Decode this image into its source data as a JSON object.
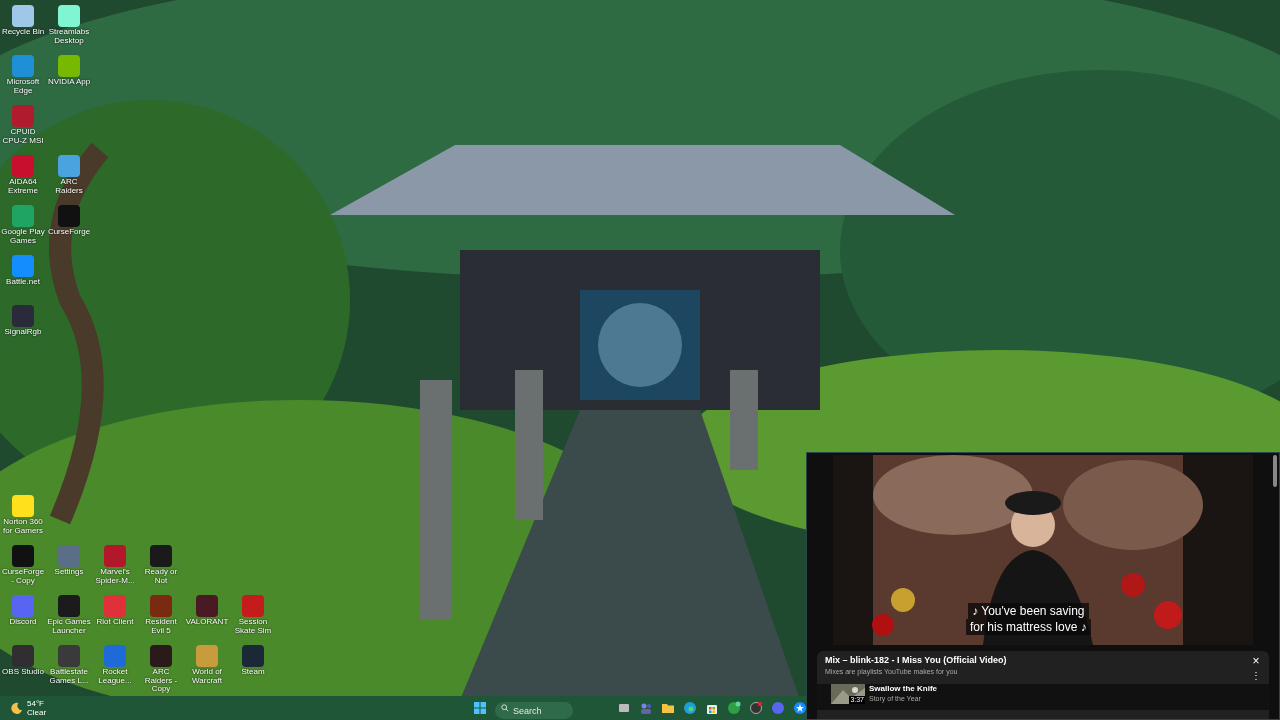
{
  "desktop": {
    "top_rows": [
      [
        {
          "label": "Recycle Bin",
          "color": "#9fc7e8"
        },
        {
          "label": "Streamlabs Desktop",
          "color": "#80f5d2"
        }
      ],
      [
        {
          "label": "Microsoft Edge",
          "color": "#1f8fd6"
        },
        {
          "label": "NVIDIA App",
          "color": "#76b900"
        }
      ],
      [
        {
          "label": "CPUID CPU-Z MSI",
          "color": "#b01c2e"
        }
      ],
      [
        {
          "label": "AIDA64 Extreme",
          "color": "#c8102e"
        },
        {
          "label": "ARC Raiders",
          "color": "#4aa3df"
        }
      ],
      [
        {
          "label": "Google Play Games",
          "color": "#1fa463"
        },
        {
          "label": "CurseForge",
          "color": "#111111"
        }
      ],
      [
        {
          "label": "Battle.net",
          "color": "#148eff"
        }
      ],
      [
        {
          "label": "SignalRgb",
          "color": "#2a2a3a"
        }
      ]
    ],
    "bottom_rows": [
      [
        {
          "label": "Norton 360 for Gamers",
          "color": "#ffe01b"
        }
      ],
      [
        {
          "label": "CurseForge - Copy",
          "color": "#111111"
        },
        {
          "label": "Settings",
          "color": "#5a6f86"
        },
        {
          "label": "Marvel's Spider-M...",
          "color": "#b3182a"
        },
        {
          "label": "Ready or Not",
          "color": "#1a1a1a"
        }
      ],
      [
        {
          "label": "Discord",
          "color": "#5865f2"
        },
        {
          "label": "Epic Games Launcher",
          "color": "#1b1b1b"
        },
        {
          "label": "Riot Client",
          "color": "#e0303a"
        },
        {
          "label": "Resident Evil 5",
          "color": "#7a2a10"
        },
        {
          "label": "VALORANT",
          "color": "#4a1a24"
        },
        {
          "label": "Session Skate Sim",
          "color": "#c41c1c"
        }
      ],
      [
        {
          "label": "OBS Studio",
          "color": "#302e31"
        },
        {
          "label": "Battlestate Games L...",
          "color": "#3a3a3a"
        },
        {
          "label": "Rocket League...",
          "color": "#1e6ad6"
        },
        {
          "label": "ARC Raiders - Copy",
          "color": "#2a1a1a"
        },
        {
          "label": "World of Warcraft",
          "color": "#c89b3c"
        },
        {
          "label": "Steam",
          "color": "#1b2838"
        }
      ]
    ]
  },
  "taskbar": {
    "weather": {
      "temperature": "54°F",
      "condition": "Clear"
    },
    "search": {
      "placeholder": "Search"
    }
  },
  "mini_player": {
    "captions": [
      "♪ You've been saving",
      "for his mattress love ♪"
    ],
    "playlist": {
      "title": "Mix – blink-182 - I Miss You (Official Video)",
      "subtitle": "Mixes are playlists YouTube makes for you",
      "close": "×",
      "menu": "⋮",
      "items": [
        {
          "title": "Swallow the Knife",
          "artist": "Story of the Year",
          "duration": "3:37"
        }
      ]
    }
  }
}
